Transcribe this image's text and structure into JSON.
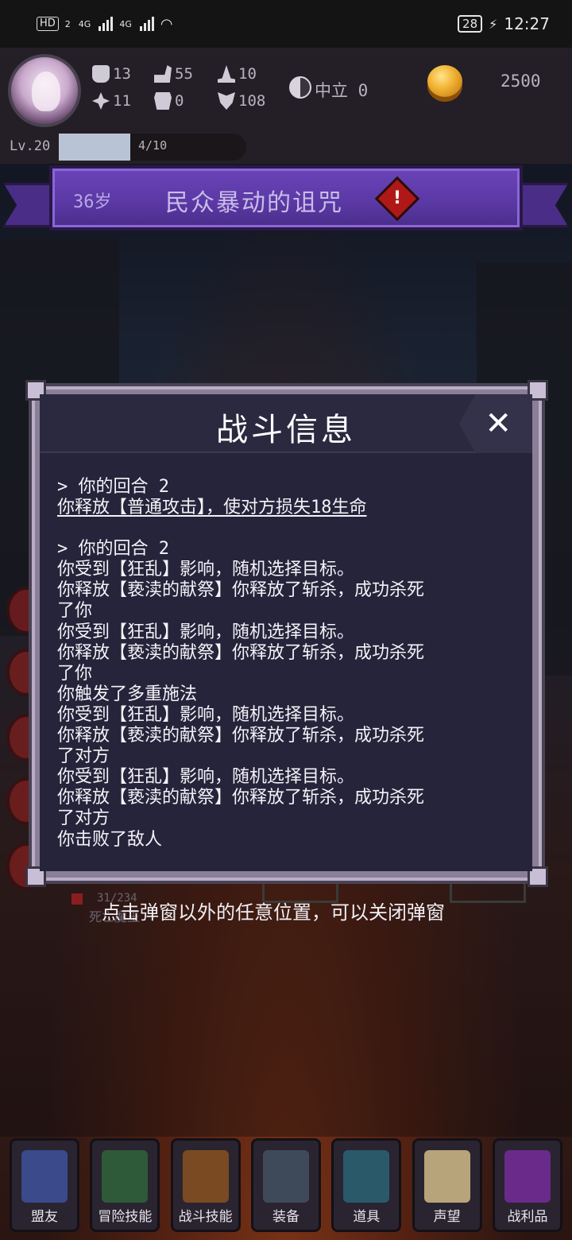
{
  "status_bar": {
    "hd_badge": "HD",
    "sim_index": "2",
    "network_1": "4G",
    "network_2": "4G",
    "battery": "28",
    "time": "12:27"
  },
  "player": {
    "stats": {
      "strength": "13",
      "agility": "55",
      "magic": "10",
      "luck": "11",
      "defense": "0",
      "spirit": "108"
    },
    "alignment": "中立 0",
    "gold": "2500",
    "level": "Lv.20",
    "xp_text": "4/10",
    "xp_progress": 0.4
  },
  "event": {
    "age": "36岁",
    "title": "民众暴动的诅咒",
    "warning_symbol": "!"
  },
  "dialog": {
    "title": "战斗信息",
    "close_symbol": "✕",
    "log_lines": [
      {
        "text": "> 你的回合 2",
        "style": "normal"
      },
      {
        "text": "你释放【普通攻击】，使对方损失18生命",
        "style": "underline"
      },
      {
        "text": "",
        "style": "blank"
      },
      {
        "text": "> 你的回合 2",
        "style": "normal"
      },
      {
        "text": "你受到【狂乱】影响，随机选择目标。",
        "style": "normal"
      },
      {
        "text": "你释放【亵渎的献祭】你释放了斩杀，成功杀死",
        "style": "normal"
      },
      {
        "text": "了你",
        "style": "normal"
      },
      {
        "text": "你受到【狂乱】影响，随机选择目标。",
        "style": "normal"
      },
      {
        "text": "你释放【亵渎的献祭】你释放了斩杀，成功杀死",
        "style": "normal"
      },
      {
        "text": "了你",
        "style": "normal"
      },
      {
        "text": "你触发了多重施法",
        "style": "normal"
      },
      {
        "text": "你受到【狂乱】影响，随机选择目标。",
        "style": "normal"
      },
      {
        "text": "你释放【亵渎的献祭】你释放了斩杀，成功杀死",
        "style": "normal"
      },
      {
        "text": "了对方",
        "style": "normal"
      },
      {
        "text": "你受到【狂乱】影响，随机选择目标。",
        "style": "normal"
      },
      {
        "text": "你释放【亵渎的献祭】你释放了斩杀，成功杀死",
        "style": "normal"
      },
      {
        "text": "了对方",
        "style": "normal"
      },
      {
        "text": "你击败了敌人",
        "style": "normal"
      }
    ]
  },
  "behind_dialog": {
    "hp_text": "31/234",
    "boss_label": "死亡魔王"
  },
  "close_hint": "点击弹窗以外的任意位置，可以关闭弹窗",
  "bottom_nav": [
    {
      "label": "盟友",
      "icon": "ally-icon",
      "color": "#3a4a8a"
    },
    {
      "label": "冒险技能",
      "icon": "adventure-book-icon",
      "color": "#2e5a3a"
    },
    {
      "label": "战斗技能",
      "icon": "backpack-icon",
      "color": "#7a4a22"
    },
    {
      "label": "装备",
      "icon": "crossed-swords-icon",
      "color": "#3e4a5a"
    },
    {
      "label": "道具",
      "icon": "pouch-icon",
      "color": "#2a5a6a"
    },
    {
      "label": "声望",
      "icon": "scroll-icon",
      "color": "#b8a47a"
    },
    {
      "label": "战利品",
      "icon": "treasure-chest-icon",
      "color": "#6a2a8a"
    }
  ]
}
